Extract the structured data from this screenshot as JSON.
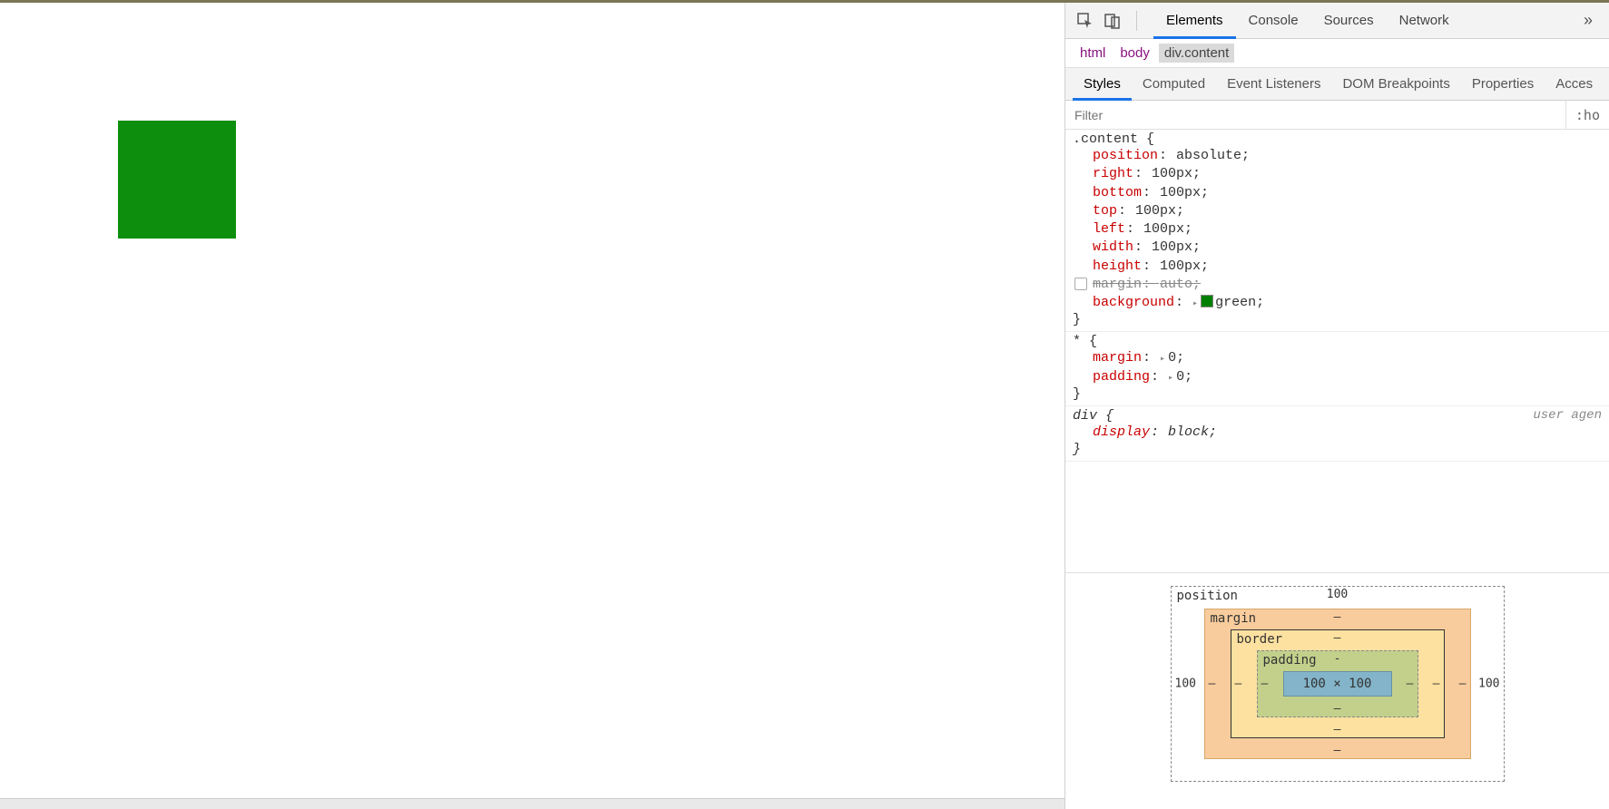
{
  "toolbar": {
    "tabs": [
      "Elements",
      "Console",
      "Sources",
      "Network"
    ],
    "active_tab": "Elements",
    "more_icon": "»"
  },
  "breadcrumb": {
    "items": [
      {
        "label": "html",
        "selected": false
      },
      {
        "label": "body",
        "selected": false
      },
      {
        "label": "div.content",
        "selected": true
      }
    ]
  },
  "panel_tabs": {
    "items": [
      "Styles",
      "Computed",
      "Event Listeners",
      "DOM Breakpoints",
      "Properties",
      "Acces"
    ],
    "active": "Styles"
  },
  "filter": {
    "placeholder": "Filter",
    "pseudo_label": ":ho"
  },
  "rules": [
    {
      "selector": ".content",
      "origin": "",
      "ua": false,
      "decls": [
        {
          "prop": "position",
          "val": "absolute",
          "expand": false,
          "disabled": false,
          "chk": false,
          "swatch": false
        },
        {
          "prop": "right",
          "val": "100px",
          "expand": false,
          "disabled": false,
          "chk": false,
          "swatch": false
        },
        {
          "prop": "bottom",
          "val": "100px",
          "expand": false,
          "disabled": false,
          "chk": false,
          "swatch": false
        },
        {
          "prop": "top",
          "val": "100px",
          "expand": false,
          "disabled": false,
          "chk": false,
          "swatch": false
        },
        {
          "prop": "left",
          "val": "100px",
          "expand": false,
          "disabled": false,
          "chk": false,
          "swatch": false
        },
        {
          "prop": "width",
          "val": "100px",
          "expand": false,
          "disabled": false,
          "chk": false,
          "swatch": false
        },
        {
          "prop": "height",
          "val": "100px",
          "expand": false,
          "disabled": false,
          "chk": false,
          "swatch": false
        },
        {
          "prop": "margin",
          "val": "auto",
          "expand": false,
          "disabled": true,
          "chk": true,
          "swatch": false
        },
        {
          "prop": "background",
          "val": "green",
          "expand": true,
          "disabled": false,
          "chk": false,
          "swatch": true
        }
      ]
    },
    {
      "selector": "*",
      "origin": "",
      "ua": false,
      "decls": [
        {
          "prop": "margin",
          "val": "0",
          "expand": true,
          "disabled": false,
          "chk": false,
          "swatch": false
        },
        {
          "prop": "padding",
          "val": "0",
          "expand": true,
          "disabled": false,
          "chk": false,
          "swatch": false
        }
      ]
    },
    {
      "selector": "div",
      "origin": "user agen",
      "ua": true,
      "decls": [
        {
          "prop": "display",
          "val": "block",
          "expand": false,
          "disabled": false,
          "chk": false,
          "swatch": false
        }
      ]
    }
  ],
  "boxmodel": {
    "position": {
      "label": "position",
      "top": "100",
      "right": "100",
      "bottom": "",
      "left": "100"
    },
    "margin": {
      "label": "margin",
      "top": "–",
      "right": "–",
      "bottom": "–",
      "left": "–"
    },
    "border": {
      "label": "border",
      "top": "–",
      "right": "–",
      "bottom": "–",
      "left": "–"
    },
    "padding": {
      "label": "padding",
      "top": "-",
      "right": "–",
      "bottom": "–",
      "left": "–"
    },
    "content": "100 × 100"
  },
  "inspected_element": {
    "color_hex": "#0d8f0d"
  }
}
